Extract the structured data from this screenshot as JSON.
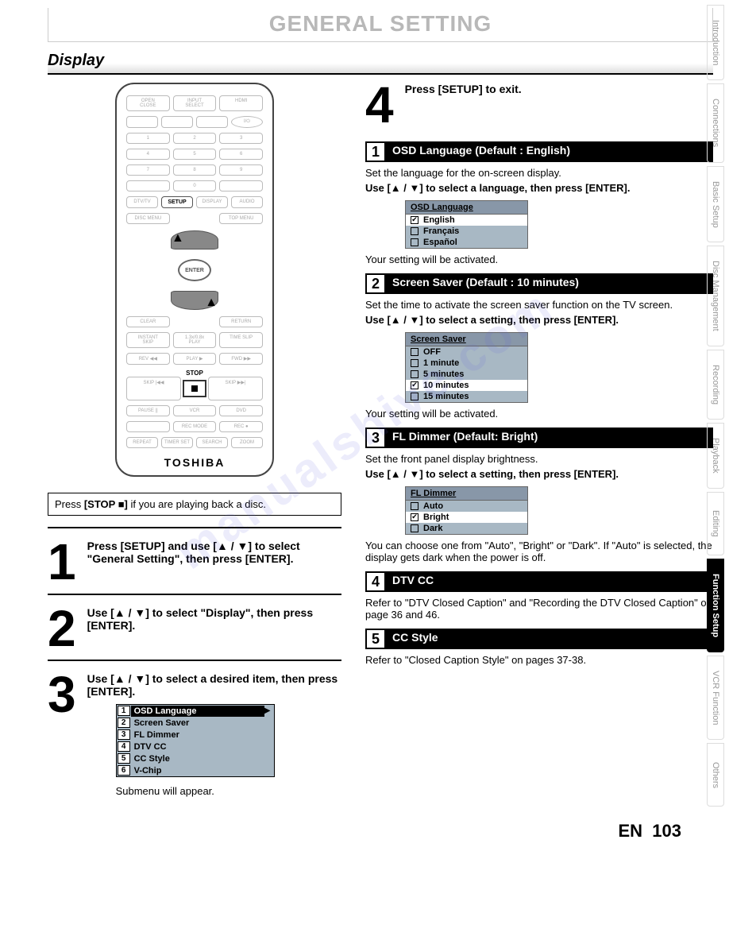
{
  "header": {
    "title": "GENERAL SETTING",
    "section": "Display"
  },
  "remote": {
    "setup_label": "SETUP",
    "enter_label": "ENTER",
    "stop_label": "STOP",
    "brand": "TOSHIBA"
  },
  "note": {
    "prefix": "Press ",
    "button": "[STOP ■]",
    "suffix": " if you are playing back a disc."
  },
  "steps_left": [
    {
      "num": "1",
      "text": "Press [SETUP] and use [▲ / ▼] to select \"General Setting\", then press [ENTER]."
    },
    {
      "num": "2",
      "text": "Use [▲ / ▼] to select \"Display\", then press [ENTER]."
    },
    {
      "num": "3",
      "text": "Use [▲ / ▼] to select a desired item, then press [ENTER]."
    }
  ],
  "display_menu": {
    "items": [
      "OSD Language",
      "Screen Saver",
      "FL Dimmer",
      "DTV CC",
      "CC Style",
      "V-Chip"
    ],
    "selected_index": 0,
    "footnote": "Submenu will appear."
  },
  "step4": {
    "num": "4",
    "text": "Press [SETUP] to exit."
  },
  "settings": [
    {
      "num": "1",
      "title": "OSD Language (Default : English)",
      "desc": "Set the language for the on-screen display.",
      "instr": "Use [▲ / ▼] to select a language, then press [ENTER].",
      "box_title": "OSD Language",
      "options": [
        {
          "label": "English",
          "checked": true
        },
        {
          "label": "Français",
          "checked": false
        },
        {
          "label": "Español",
          "checked": false
        }
      ],
      "result": "Your setting will be activated."
    },
    {
      "num": "2",
      "title": "Screen Saver (Default : 10 minutes)",
      "desc": "Set the time to activate the screen saver function on the TV screen.",
      "instr": "Use [▲ / ▼] to select a setting, then press [ENTER].",
      "box_title": "Screen Saver",
      "options": [
        {
          "label": "OFF",
          "checked": false
        },
        {
          "label": "1 minute",
          "checked": false
        },
        {
          "label": "5 minutes",
          "checked": false
        },
        {
          "label": "10 minutes",
          "checked": true
        },
        {
          "label": "15 minutes",
          "checked": false
        }
      ],
      "result": "Your setting will be activated."
    },
    {
      "num": "3",
      "title": "FL Dimmer (Default: Bright)",
      "desc": "Set the front panel display brightness.",
      "instr": "Use [▲ / ▼] to select a setting, then press [ENTER].",
      "box_title": "FL Dimmer",
      "options": [
        {
          "label": "Auto",
          "checked": false
        },
        {
          "label": "Bright",
          "checked": true
        },
        {
          "label": "Dark",
          "checked": false
        }
      ],
      "result": "You can choose one from \"Auto\", \"Bright\" or \"Dark\". If \"Auto\" is selected, the display gets dark when the power is off."
    },
    {
      "num": "4",
      "title": "DTV CC",
      "desc": "Refer to \"DTV Closed Caption\" and \"Recording the DTV Closed Caption\" on page 36 and 46."
    },
    {
      "num": "5",
      "title": "CC Style",
      "desc": "Refer to \"Closed Caption Style\" on pages 37-38."
    }
  ],
  "tabs": [
    "Introduction",
    "Connections",
    "Basic Setup",
    "Disc Management",
    "Recording",
    "Playback",
    "Editing",
    "Function Setup",
    "VCR Function",
    "Others"
  ],
  "active_tab_index": 7,
  "footer": {
    "lang": "EN",
    "page": "103"
  },
  "watermark": "manualshive.com"
}
